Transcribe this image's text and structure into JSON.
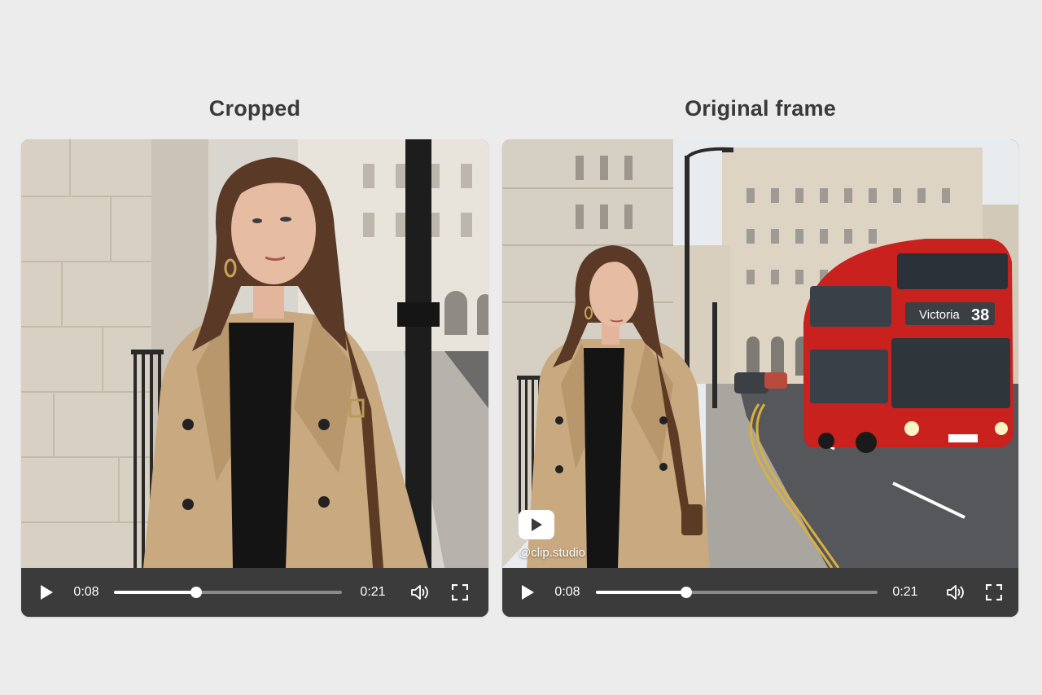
{
  "panels": [
    {
      "title": "Cropped",
      "player": {
        "current_time": "0:08",
        "total_time": "0:21",
        "progress": 0.36
      }
    },
    {
      "title": "Original frame",
      "player": {
        "current_time": "0:08",
        "total_time": "0:21",
        "progress": 0.32
      },
      "bus_sign": {
        "destination": "Victoria",
        "route": "38"
      },
      "watermark": {
        "handle": "@clip.studio",
        "icon": "play-logo-icon"
      }
    }
  ],
  "icons": {
    "play": "play-icon",
    "volume": "volume-icon",
    "fullscreen": "fullscreen-icon"
  },
  "colors": {
    "background": "#ececec",
    "control_bar": "#3b3b3b",
    "bus_red": "#c8211e"
  }
}
